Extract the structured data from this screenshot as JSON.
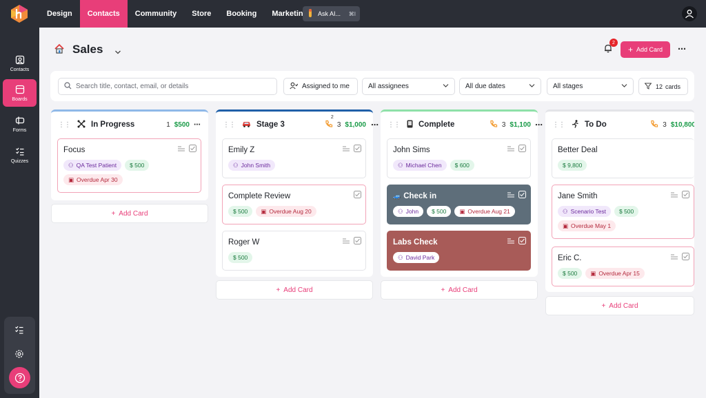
{
  "topnav": {
    "items": [
      "Design",
      "Contacts",
      "Community",
      "Store",
      "Booking",
      "Marketing"
    ],
    "active_index": 1,
    "ask_ai_label": "Ask AI...",
    "ask_ai_shortcut": "⌘I"
  },
  "sidebar": {
    "items": [
      {
        "label": "Contacts",
        "icon": "contacts-icon"
      },
      {
        "label": "Boards",
        "icon": "boards-icon",
        "active": true
      },
      {
        "label": "Forms",
        "icon": "forms-icon"
      },
      {
        "label": "Quizzes",
        "icon": "quizzes-icon"
      }
    ]
  },
  "header": {
    "title": "Sales",
    "notification_count": "2",
    "add_card_label": "Add Card"
  },
  "filters": {
    "search_placeholder": "Search title, contact, email, or details",
    "assigned_to_me": "Assigned to me",
    "assignees": "All assignees",
    "due_dates": "All due dates",
    "stages": "All stages",
    "cards_count": "12",
    "cards_label": "cards"
  },
  "columns": [
    {
      "title": "In Progress",
      "count": "1",
      "total": "$500",
      "color": "#8fb8e8",
      "cards": [
        {
          "title": "Focus",
          "person": "QA Test Patient",
          "amount": "$ 500",
          "overdue": "Overdue Apr 30"
        }
      ]
    },
    {
      "title": "Stage 3",
      "count": "3",
      "total": "$1,000",
      "color": "#1f5fa8",
      "badge": "2",
      "cards": [
        {
          "title": "Emily Z",
          "person": "John Smith"
        },
        {
          "title": "Complete Review",
          "amount": "$ 500",
          "overdue": "Overdue Aug 20"
        },
        {
          "title": "Roger W",
          "amount": "$ 500"
        }
      ]
    },
    {
      "title": "Complete",
      "count": "3",
      "total": "$1,100",
      "color": "#8ee0a8",
      "cards": [
        {
          "title": "John Sims",
          "person": "Michael Chen",
          "amount": "$ 600"
        },
        {
          "title": "Check in",
          "person": "John",
          "amount": "$ 500",
          "overdue": "Overdue Aug 21"
        },
        {
          "title": "Labs Check",
          "person": "David Park"
        }
      ]
    },
    {
      "title": "To Do",
      "count": "3",
      "total": "$10,800",
      "color": "#e3e4e8",
      "cards": [
        {
          "title": "Better Deal",
          "amount": "$ 9,800"
        },
        {
          "title": "Jane Smith",
          "person": "Scenario Test",
          "amount": "$ 500",
          "overdue": "Overdue May 1"
        },
        {
          "title": "Eric C.",
          "amount": "$ 500",
          "overdue": "Overdue Apr 15"
        }
      ]
    }
  ],
  "add_card_label": "Add Card"
}
